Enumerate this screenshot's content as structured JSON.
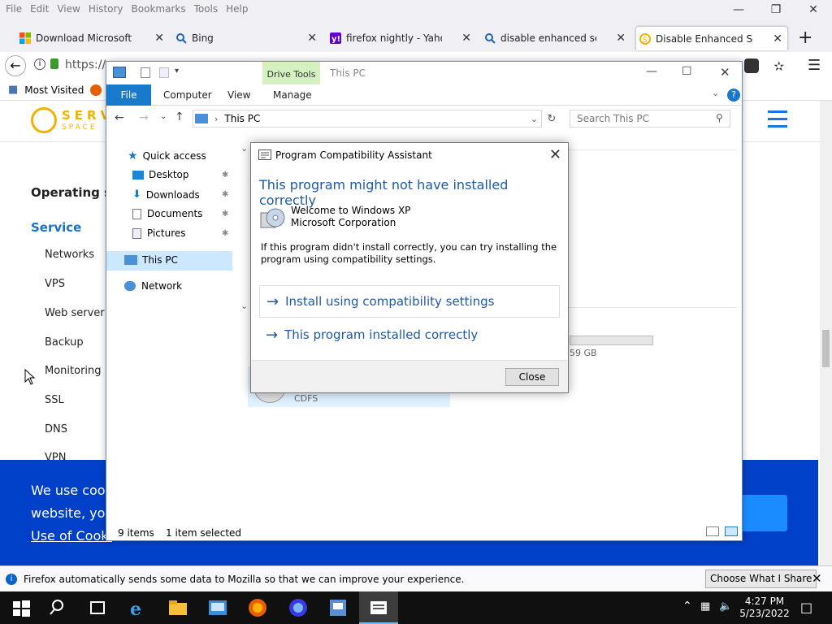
{
  "menubar": {
    "items": [
      "File",
      "Edit",
      "View",
      "History",
      "Bookmarks",
      "Tools",
      "Help"
    ]
  },
  "tabs": [
    {
      "title": "Download Microsoft Edg",
      "icon": "microsoft-logo-icon"
    },
    {
      "title": "Bing",
      "icon": "search-icon"
    },
    {
      "title": "firefox nightly - Yahoo Se",
      "icon": "yahoo-logo-icon"
    },
    {
      "title": "disable enhanced securit",
      "icon": "search-icon"
    },
    {
      "title": "Disable Enhanced Securi",
      "icon": "servespace-favicon-icon"
    }
  ],
  "navbar": {
    "url": "https://s"
  },
  "bookmarks": {
    "most_visited": "Most Visited"
  },
  "webpage": {
    "logo_text_1": "SERV",
    "logo_text_2": "SPACE",
    "heading": "Operating sys",
    "service": "Service",
    "items": [
      "Networks",
      "VPS",
      "Web server",
      "Backup",
      "Monitoring",
      "SSL",
      "DNS",
      "VPN"
    ],
    "cookie_line1": "We use cook",
    "cookie_line2": "website, you",
    "cookie_link": "Use of Cooki",
    "accent": "#0040c8"
  },
  "notification": {
    "text": "Firefox automatically sends some data to Mozilla so that we can improve your experience.",
    "button": "Choose What I Share"
  },
  "explorer": {
    "title": "This PC",
    "drive_tools": "Drive Tools",
    "ribbon": {
      "file": "File",
      "computer": "Computer",
      "view": "View",
      "manage": "Manage"
    },
    "address": "This PC",
    "search_placeholder": "Search This PC",
    "nav": {
      "quick_access": "Quick access",
      "desktop": "Desktop",
      "downloads": "Downloads",
      "documents": "Documents",
      "pictures": "Pictures",
      "this_pc": "This PC",
      "network": "Network"
    },
    "drive_size": "59 GB",
    "drive_label": "CDFS",
    "status_items": "9 items",
    "status_selected": "1 item selected"
  },
  "dialog": {
    "title": "Program Compatibility Assistant",
    "heading": "This program might not have installed correctly",
    "program_name": "Welcome to Windows XP",
    "publisher": "Microsoft Corporation",
    "description": "If this program didn't install correctly, you can try installing the program using compatibility settings.",
    "option1": "Install using compatibility settings",
    "option2": "This program installed correctly",
    "close": "Close"
  },
  "taskbar": {
    "time": "4:27 PM",
    "date": "5/23/2022"
  }
}
